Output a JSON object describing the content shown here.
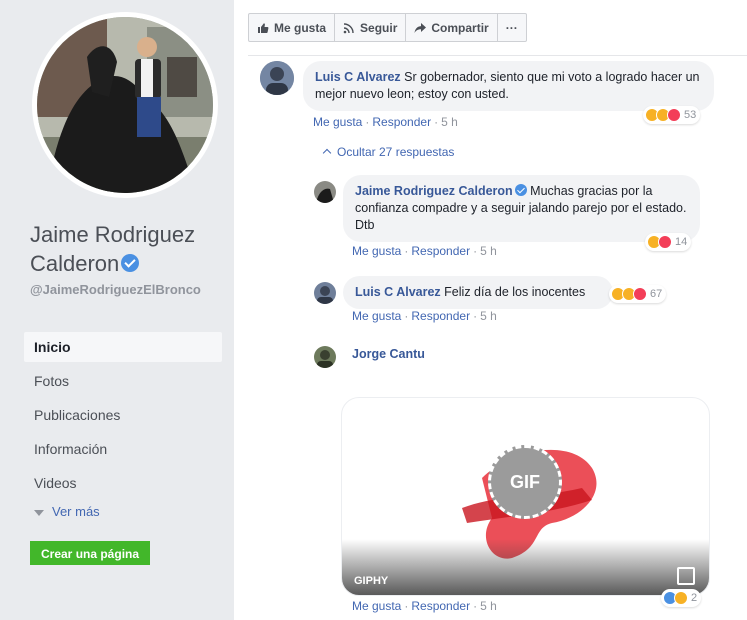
{
  "profile": {
    "name": "Jaime Rodriguez Calderon",
    "handle": "@JaimeRodriguezElBronco"
  },
  "sidebar": {
    "items": [
      {
        "label": "Inicio",
        "active": true
      },
      {
        "label": "Fotos"
      },
      {
        "label": "Publicaciones"
      },
      {
        "label": "Información"
      },
      {
        "label": "Videos"
      }
    ],
    "see_more": "Ver más",
    "create_page": "Crear una página"
  },
  "toolbar": {
    "like": "Me gusta",
    "follow": "Seguir",
    "share": "Compartir",
    "more": "···"
  },
  "actions": {
    "like": "Me gusta",
    "reply": "Responder",
    "sep": "·"
  },
  "comments": [
    {
      "author": "Luis C Alvarez",
      "text": "Sr gobernador, siento que mi voto a logrado hacer un mejor nuevo leon; estoy con usted.",
      "time": "5 h",
      "reactions": [
        "haha",
        "wow",
        "love"
      ],
      "reaction_count": "53"
    }
  ],
  "toggle_replies": "Ocultar 27 respuestas",
  "replies": [
    {
      "author": "Jaime Rodriguez Calderon",
      "verified": true,
      "text": "Muchas gracias por la confianza compadre y a seguir jalando parejo por el estado. Dtb",
      "time": "5 h",
      "reactions": [
        "haha",
        "love"
      ],
      "reaction_count": "14"
    },
    {
      "author": "Luis C Alvarez",
      "text": "Feliz día de los inocentes",
      "time": "5 h",
      "reactions": [
        "haha",
        "wow",
        "love"
      ],
      "reaction_count": "67"
    },
    {
      "author": "Jorge Cantu",
      "gif_label": "GIF",
      "gif_source": "GIPHY",
      "time": "5 h",
      "reactions": [
        "like",
        "haha"
      ],
      "reaction_count": "2"
    }
  ],
  "colors": {
    "link": "#385898",
    "action": "#4267b2",
    "sidebar_bg": "#e9ebee",
    "create_btn": "#42b72a",
    "bubble": "#f2f3f5"
  },
  "icons": [
    "thumbs-up-icon",
    "rss-icon",
    "share-arrow-icon",
    "more-icon",
    "verified-icon",
    "chevron-up-icon",
    "caret-down-icon",
    "open-external-icon"
  ]
}
